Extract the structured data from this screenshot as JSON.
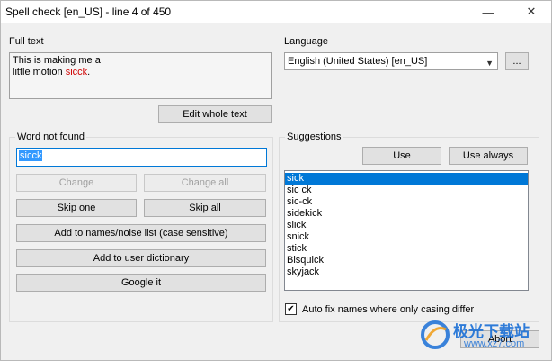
{
  "window": {
    "title": "Spell check [en_US] - line 4 of 450",
    "minimize_glyph": "—",
    "close_glyph": "✕"
  },
  "full_text": {
    "label": "Full text",
    "line1": "This is making me a",
    "line2_prefix": "little motion ",
    "line2_error": "sicck",
    "line2_suffix": ".",
    "edit_button": "Edit whole text"
  },
  "language": {
    "label": "Language",
    "selected": "English (United States) [en_US]",
    "more_button": "..."
  },
  "word_not_found": {
    "title": "Word not found",
    "value": "sicck",
    "buttons": {
      "change": "Change",
      "change_all": "Change all",
      "skip_one": "Skip one",
      "skip_all": "Skip all",
      "add_names": "Add to names/noise list (case sensitive)",
      "add_user_dict": "Add to user dictionary",
      "google_it": "Google it"
    }
  },
  "suggestions": {
    "title": "Suggestions",
    "use_button": "Use",
    "use_always_button": "Use always",
    "items": [
      "sick",
      "sic ck",
      "sic-ck",
      "sidekick",
      "slick",
      "snick",
      "stick",
      "Bisquick",
      "skyjack"
    ],
    "selected_index": 0,
    "auto_fix_label": "Auto fix names where only casing differ",
    "auto_fix_checked": true
  },
  "footer": {
    "abort_button": "Abort"
  },
  "watermark": {
    "brand_text": "极光下载站",
    "url_text": "www.xz7.com"
  },
  "colors": {
    "selection_blue": "#0078d7",
    "error_red": "#d00000",
    "watermark_blue": "#1a6fd6"
  }
}
